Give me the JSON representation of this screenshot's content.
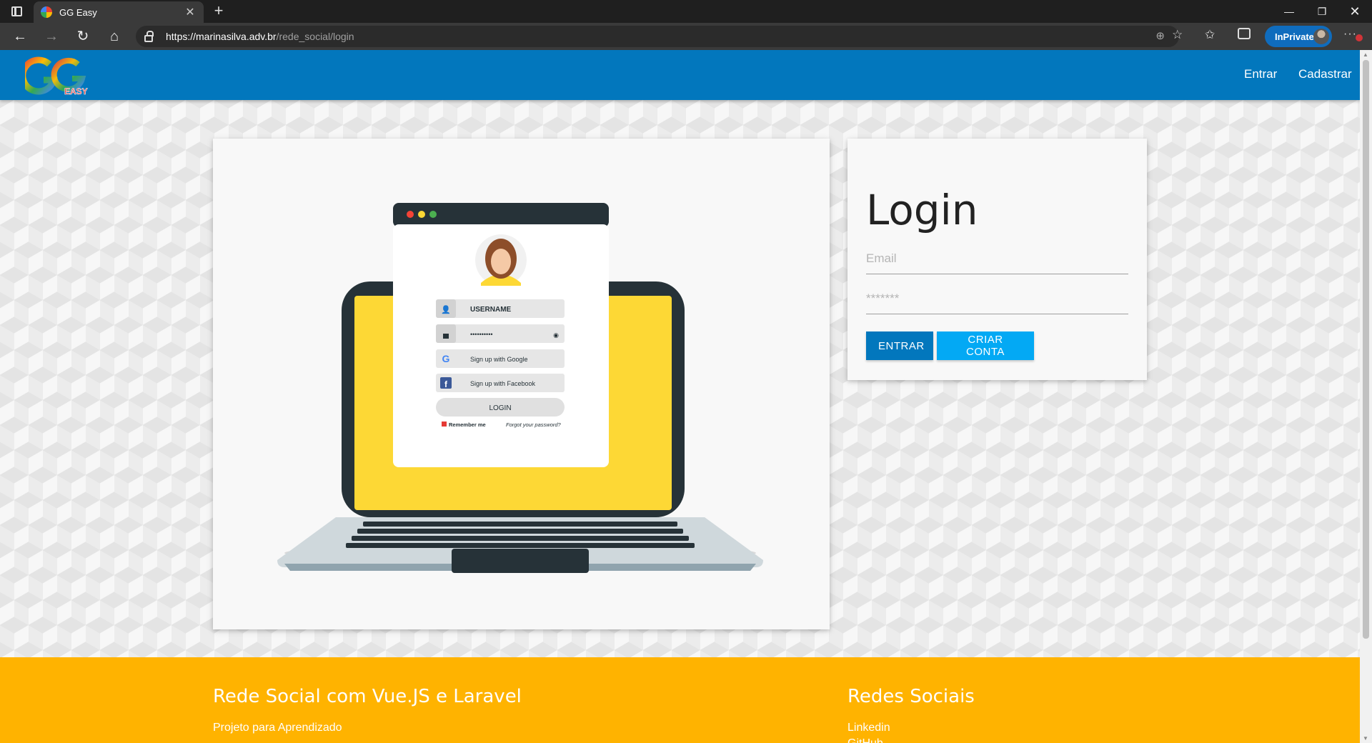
{
  "browser": {
    "tab_title": "GG Easy",
    "url_host": "https://marinasilva.adv.br",
    "url_path": "/rede_social/login",
    "inprivate_label": "InPrivate",
    "more_label": "···"
  },
  "header": {
    "logo_letters": "GG",
    "logo_sub": "EASY",
    "links": [
      {
        "label": "Entrar"
      },
      {
        "label": "Cadastrar"
      }
    ],
    "color": "#0277bd"
  },
  "illustration": {
    "username_label": "USERNAME",
    "password_mask": "••••••••••",
    "google_label": "Sign up with Google",
    "facebook_label": "Sign up with Facebook",
    "login_label": "LOGIN",
    "remember_label": "Remember me",
    "forgot_label": "Forgot your password?"
  },
  "login": {
    "title": "Login",
    "email_placeholder": "Email",
    "password_placeholder": "*******",
    "entrar_label": "ENTRAR",
    "criar_label": "CRIAR CONTA"
  },
  "footer": {
    "left_title": "Rede Social com Vue.JS e Laravel",
    "left_desc": "Projeto para Aprendizado",
    "right_title": "Redes Sociais",
    "links": [
      {
        "label": "Linkedin"
      },
      {
        "label": "GitHub"
      }
    ],
    "color": "#ffb300"
  }
}
